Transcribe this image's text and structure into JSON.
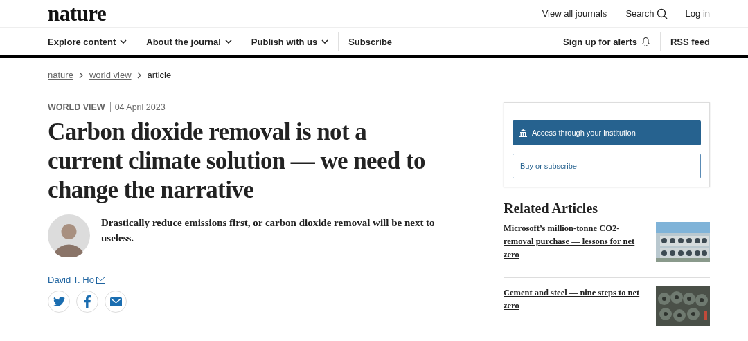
{
  "logo": "nature",
  "top_links": [
    {
      "label": "View all journals",
      "kind": "link"
    },
    {
      "label": "Search",
      "kind": "search"
    },
    {
      "label": "Log in",
      "kind": "link"
    }
  ],
  "nav": [
    {
      "label": "Explore content",
      "kind": "menu"
    },
    {
      "label": "About the journal",
      "kind": "menu"
    },
    {
      "label": "Publish with us",
      "kind": "menu"
    },
    {
      "label": "Subscribe",
      "kind": "link"
    }
  ],
  "nav_right": [
    {
      "label": "Sign up for alerts",
      "kind": "alerts"
    },
    {
      "label": "RSS feed",
      "kind": "link"
    }
  ],
  "breadcrumb": [
    {
      "label": "nature",
      "link": true
    },
    {
      "label": "world view",
      "link": true
    },
    {
      "label": "article",
      "link": false
    }
  ],
  "article": {
    "section": "WORLD VIEW",
    "date": "04 April 2023",
    "title": "Carbon dioxide removal is not a current climate solution — we need to change the narrative",
    "standfirst": "Drastically reduce emissions first, or carbon dioxide removal will be next to useless.",
    "author": "David T. Ho",
    "share": [
      {
        "kind": "twitter"
      },
      {
        "kind": "facebook"
      },
      {
        "kind": "email"
      }
    ]
  },
  "access": {
    "institution": "Access through your institution",
    "buy": "Buy or subscribe"
  },
  "related": {
    "heading": "Related Articles",
    "items": [
      {
        "title": "Microsoft’s million-tonne CO2-removal purchase — lessons for net zero"
      },
      {
        "title": "Cement and steel — nine steps to net zero"
      }
    ]
  }
}
